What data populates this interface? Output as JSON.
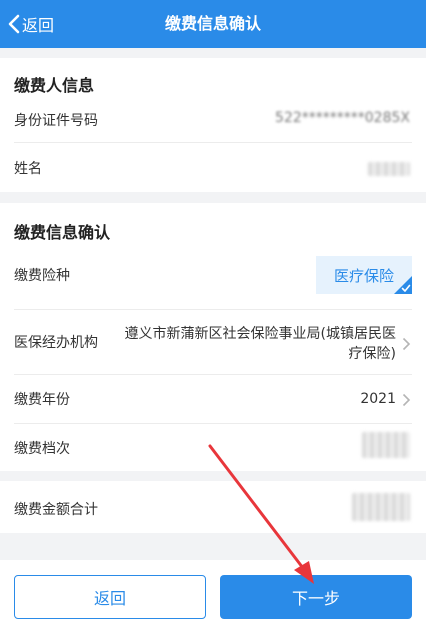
{
  "nav": {
    "back_label": "返回",
    "title": "缴费信息确认"
  },
  "payer": {
    "section_title": "缴费人信息",
    "id_label": "身份证件号码",
    "id_value": "522*********0285X",
    "name_label": "姓名"
  },
  "payment": {
    "section_title": "缴费信息确认",
    "insurance_label": "缴费险种",
    "insurance_value": "医疗保险",
    "agency_label": "医保经办机构",
    "agency_value": "遵义市新蒲新区社会保险事业局(城镇居民医疗保险)",
    "year_label": "缴费年份",
    "year_value": "2021",
    "level_label": "缴费档次"
  },
  "total": {
    "label": "缴费金额合计"
  },
  "footer": {
    "back_button": "返回",
    "next_button": "下一步"
  },
  "colors": {
    "primary": "#2a8be8",
    "chip_bg": "#e6f2fd",
    "annotation_arrow": "#e8363b"
  },
  "icons": {
    "back": "chevron-left-icon",
    "row_more": "chevron-right-icon",
    "selected": "checkmark-icon"
  }
}
